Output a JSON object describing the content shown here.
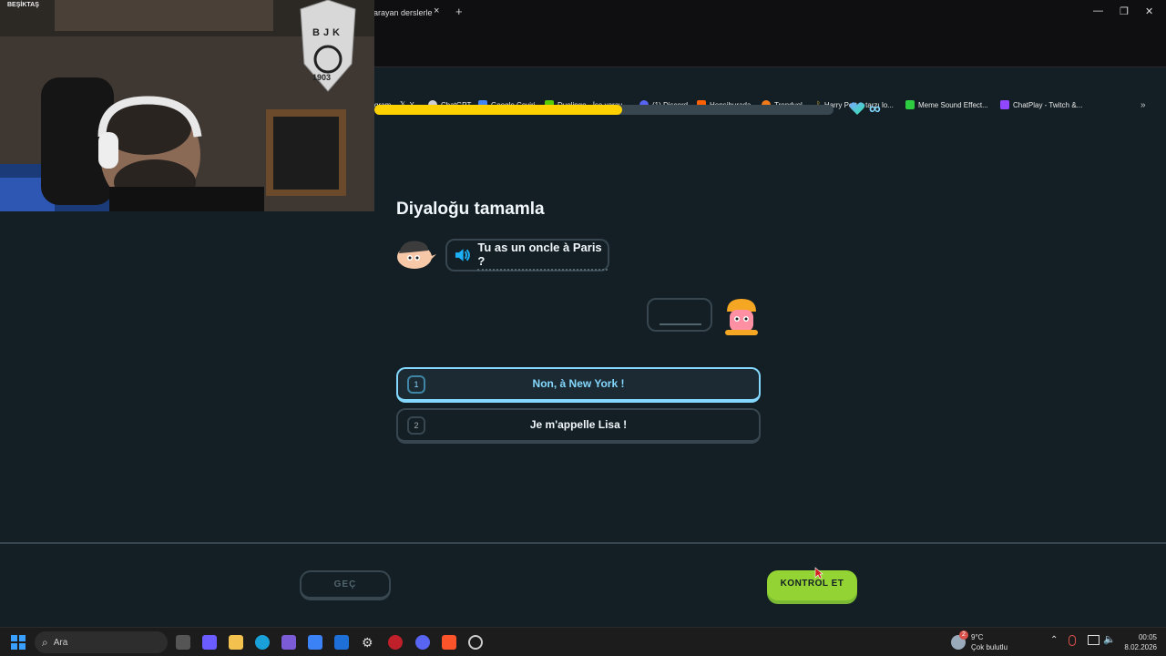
{
  "browser": {
    "tab_title": "arayan derslerle",
    "tab_close": "×",
    "new_tab": "+",
    "bookmarks": [
      {
        "label": "gram",
        "icon": "instagram-icon"
      },
      {
        "label": "X",
        "icon": "x-icon"
      },
      {
        "label": "ChatGPT",
        "icon": "chatgpt-icon"
      },
      {
        "label": "Google Çeviri",
        "icon": "google-translate-icon"
      },
      {
        "label": "Duolingo - İşe yaray...",
        "icon": "duolingo-icon"
      },
      {
        "label": "(1) Discord",
        "icon": "discord-icon"
      },
      {
        "label": "Hepsiburada",
        "icon": "hepsiburada-icon"
      },
      {
        "label": "Trendyol",
        "icon": "trendyol-icon"
      },
      {
        "label": "Harry Potter tarzı lo...",
        "icon": "harry-potter-icon"
      },
      {
        "label": "Meme Sound Effect...",
        "icon": "meme-sound-icon"
      },
      {
        "label": "ChatPlay - Twitch &...",
        "icon": "chatplay-icon"
      }
    ]
  },
  "webcam": {
    "banner_text": "BEŞİKTAŞ",
    "badge_letters": "BJK",
    "badge_year": "1903"
  },
  "lesson": {
    "progress": 0.54,
    "hearts": "∞",
    "title": "Diyaloğu tamamla",
    "prompt": "Tu as un oncle à Paris ?",
    "choices": [
      {
        "num": "1",
        "label": "Non, à New York !",
        "selected": true
      },
      {
        "num": "2",
        "label": "Je m'appelle Lisa !",
        "selected": false
      }
    ],
    "skip_label": "GEÇ",
    "check_label": "KONTROL ET"
  },
  "taskbar": {
    "search_placeholder": "Ara",
    "weather_temp": "9°C",
    "weather_desc": "Çok bulutlu",
    "weather_badge": "2",
    "time": "00:05",
    "date": "8.02.2026"
  },
  "colors": {
    "background": "#131f24",
    "progress": "#fdd000",
    "check_button": "#93d333",
    "selected_choice": "#84d8ff"
  }
}
